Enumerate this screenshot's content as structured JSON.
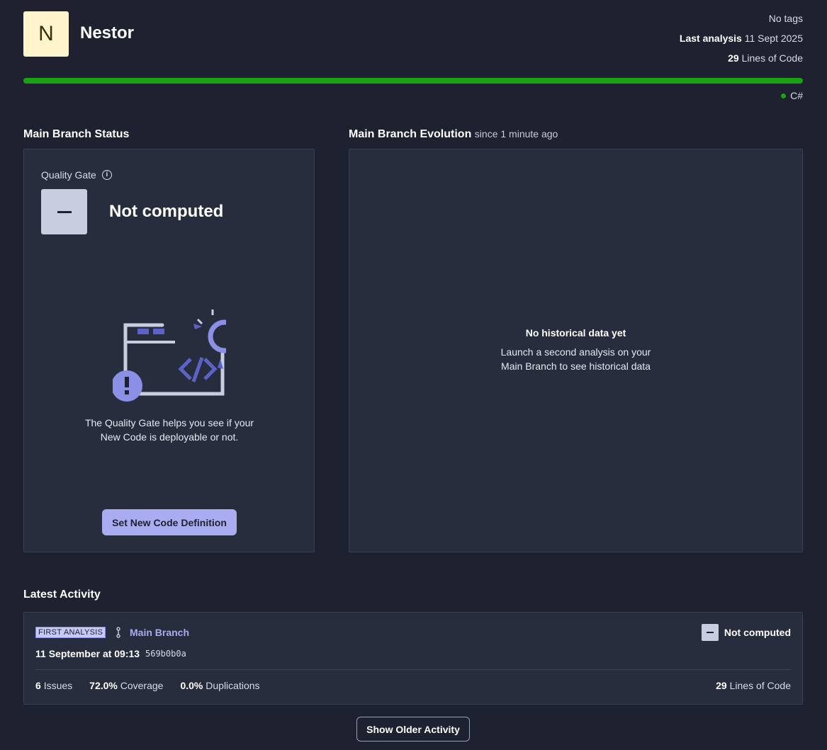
{
  "project": {
    "initial": "N",
    "name": "Nestor",
    "tags": "No tags",
    "last_analysis_label": "Last analysis",
    "last_analysis_date": "11 Sept 2025",
    "lines_of_code_value": "29",
    "lines_of_code_label": "Lines of Code",
    "language": "C#"
  },
  "status": {
    "title": "Main Branch Status",
    "quality_gate_label": "Quality Gate",
    "quality_gate_status": "Not computed",
    "help_text": "The Quality Gate helps you see if your New Code is deployable or not.",
    "set_new_code_button": "Set New Code Definition"
  },
  "evolution": {
    "title": "Main Branch Evolution",
    "since": "since 1 minute ago",
    "empty_title": "No historical data yet",
    "empty_desc": "Launch a second analysis on your Main Branch to see historical data"
  },
  "activity": {
    "title": "Latest Activity",
    "badge": "FIRST ANALYSIS",
    "branch": "Main Branch",
    "status": "Not computed",
    "date": "11 September at 09:13",
    "hash": "569b0b0a",
    "issues_value": "6",
    "issues_label": "Issues",
    "coverage_value": "72.0%",
    "coverage_label": "Coverage",
    "duplications_value": "0.0%",
    "duplications_label": "Duplications",
    "loc_value": "29",
    "loc_label": "Lines of Code",
    "show_older_button": "Show Older Activity"
  },
  "icons": {
    "info": "info-icon",
    "branch": "branch-icon",
    "language_dot": "language-dot-icon"
  },
  "colors": {
    "background": "#1e2130",
    "card": "#282d3e",
    "accent": "#a9acf0",
    "size_bar": "#1aa114",
    "avatar": "#fff4cc"
  }
}
